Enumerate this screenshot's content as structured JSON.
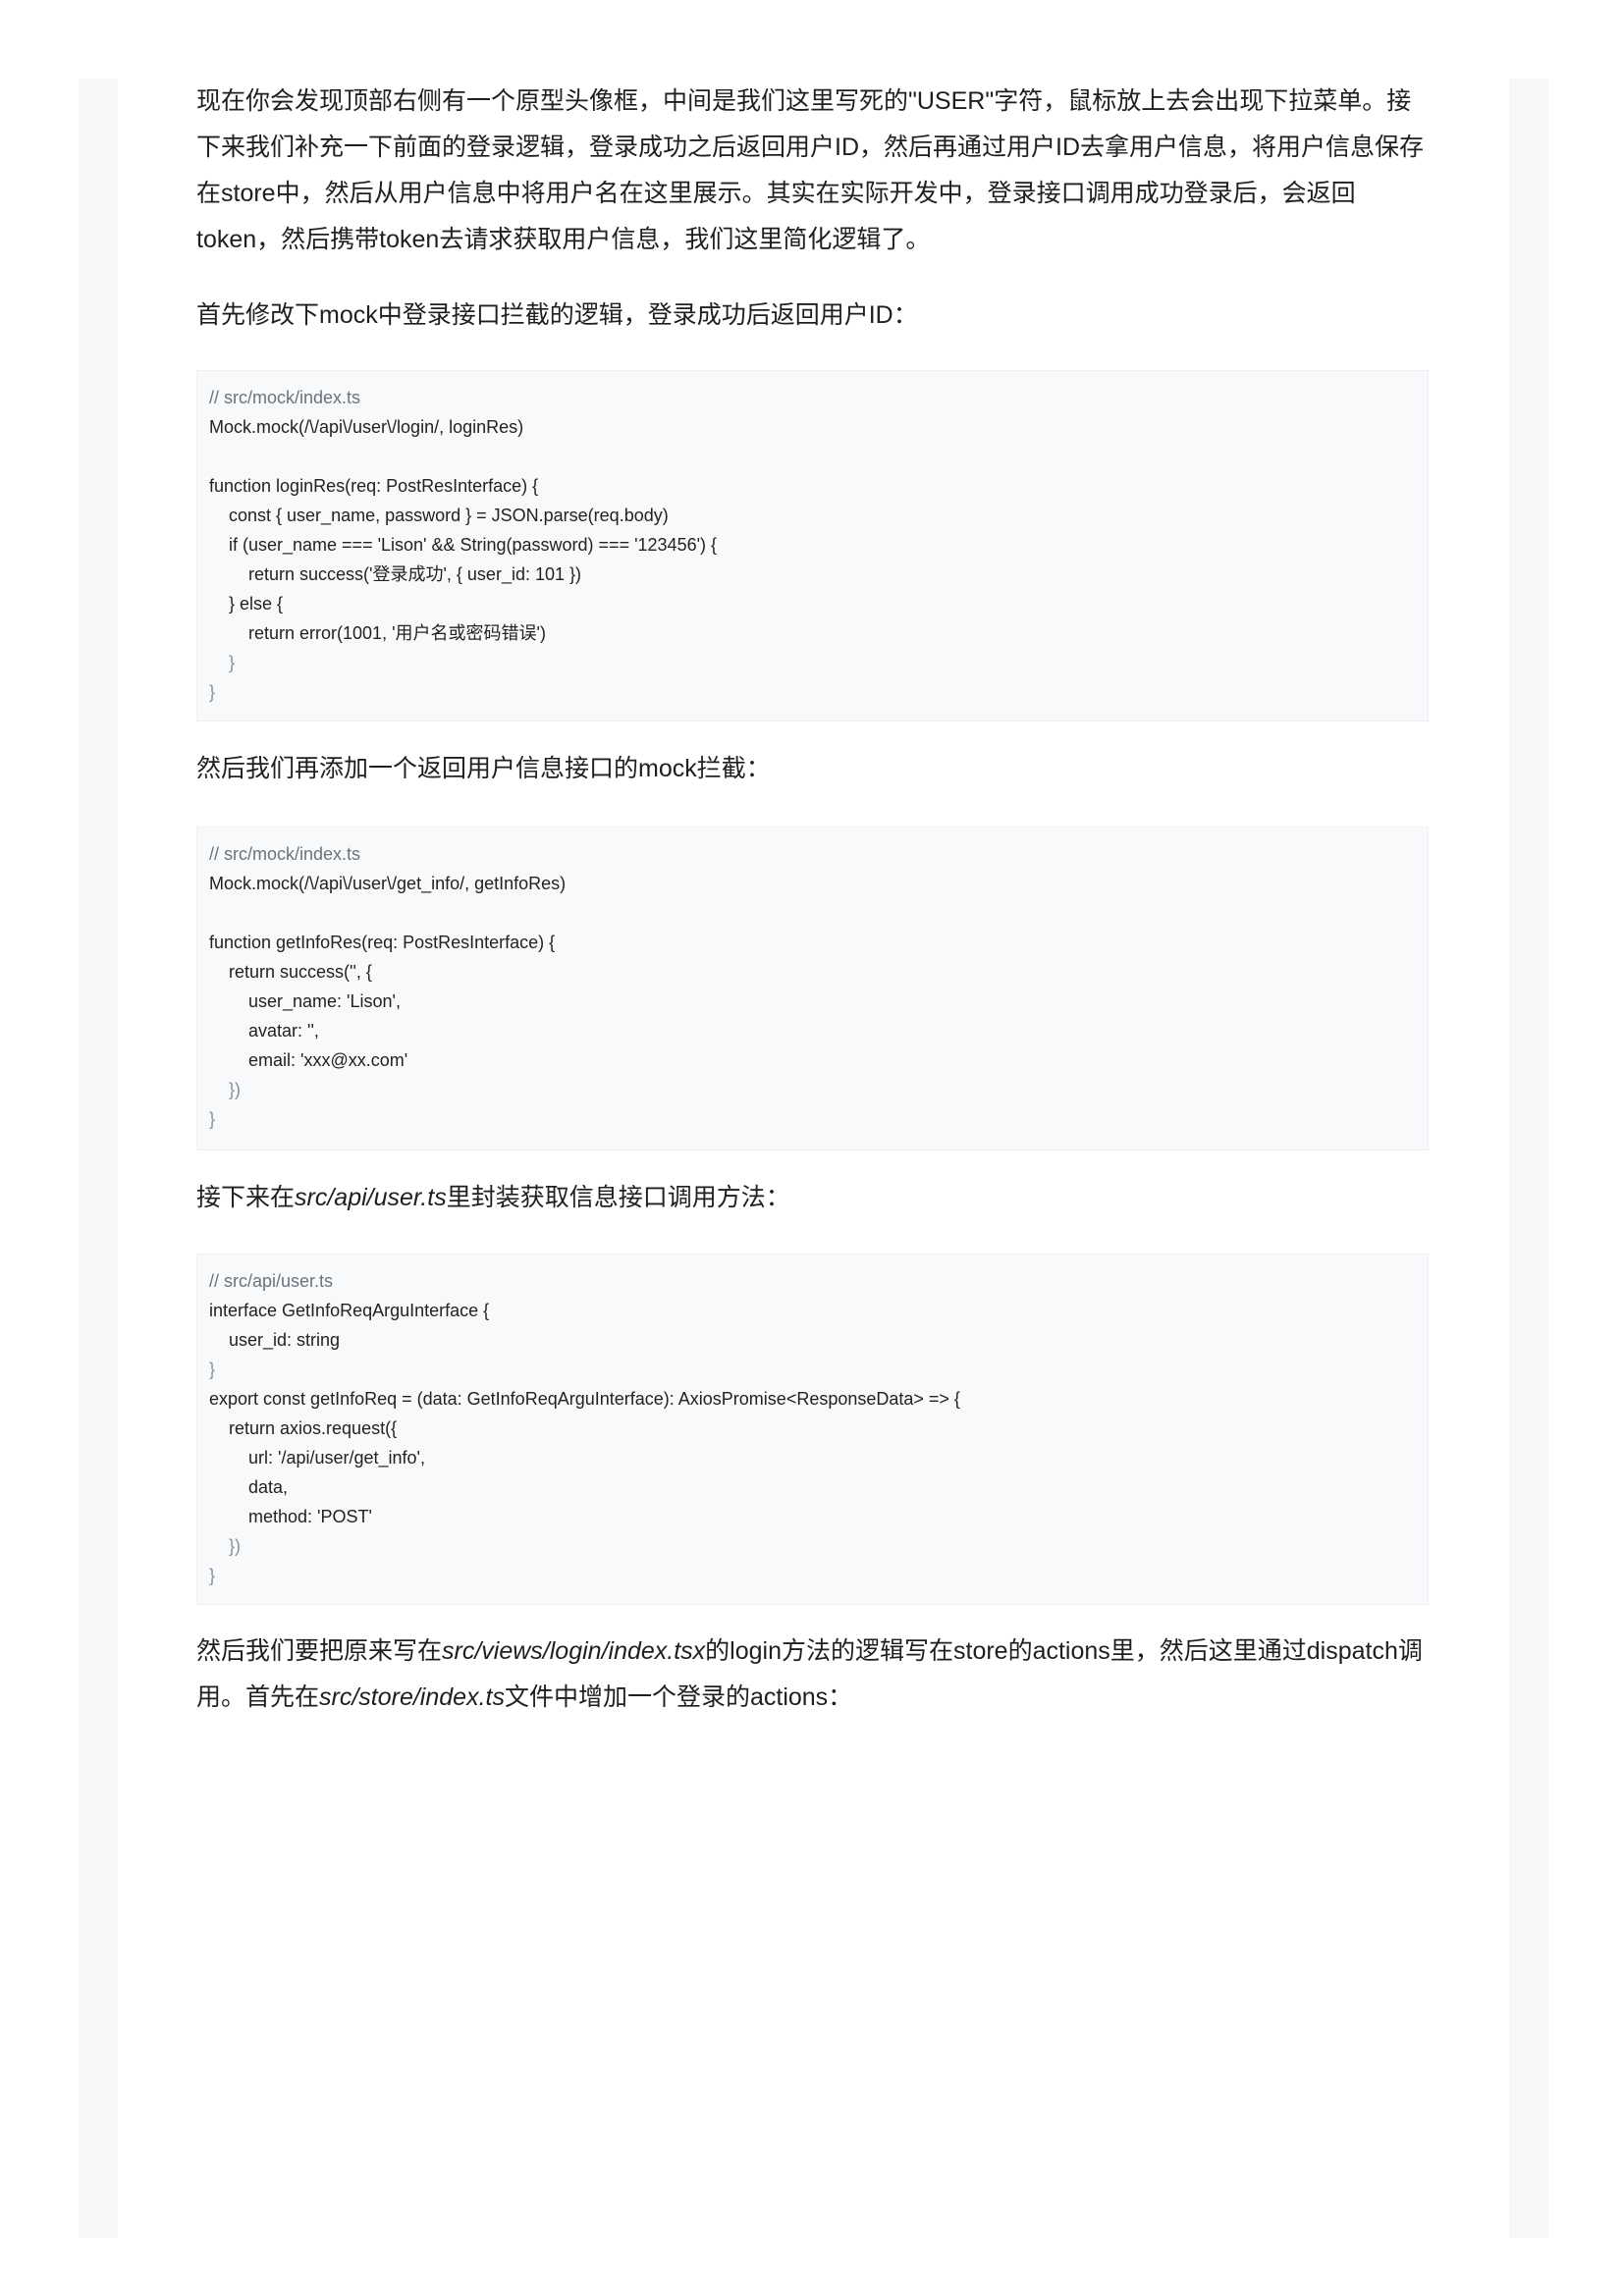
{
  "paragraphs": {
    "p1": "现在你会发现顶部右侧有一个原型头像框，中间是我们这里写死的\"USER\"字符，鼠标放上去会出现下拉菜单。接下来我们补充一下前面的登录逻辑，登录成功之后返回用户ID，然后再通过用户ID去拿用户信息，将用户信息保存在store中，然后从用户信息中将用户名在这里展示。其实在实际开发中，登录接口调用成功登录后，会返回token，然后携带token去请求获取用户信息，我们这里简化逻辑了。",
    "p2": "首先修改下mock中登录接口拦截的逻辑，登录成功后返回用户ID：",
    "p3": "然后我们再添加一个返回用户信息接口的mock拦截：",
    "p4_pre": "接下来在",
    "p4_path": "src/api/user.ts",
    "p4_post": "里封装获取信息接口调用方法：",
    "p5_a": "然后我们要把原来写在",
    "p5_path1": "src/views/login/index.tsx",
    "p5_b": "的login方法的逻辑写在store的actions里，然后这里通过dispatch调用。首先在",
    "p5_path2": "src/store/index.ts",
    "p5_c": "文件中增加一个登录的actions："
  },
  "code_blocks": [
    {
      "lines": [
        "// src/mock/index.ts",
        "Mock.mock(/\\/api\\/user\\/login/, loginRes)",
        "",
        "function loginRes(req: PostResInterface) {",
        "const { user_name, password } = JSON.parse(req.body)",
        "if (user_name === 'Lison' && String(password) === '123456') {",
        "return success('登录成功', { user_id: 101 })",
        "} else {",
        "return error(1001, '用户名或密码错误')",
        "}",
        "}"
      ]
    },
    {
      "lines": [
        "// src/mock/index.ts",
        "Mock.mock(/\\/api\\/user\\/get_info/, getInfoRes)",
        "",
        "function getInfoRes(req: PostResInterface) {",
        "return success('', {",
        "user_name: 'Lison',",
        "avatar: '',",
        "email: 'xxx@xx.com'",
        "})",
        "}"
      ]
    },
    {
      "lines": [
        "// src/api/user.ts",
        "interface GetInfoReqArguInterface {",
        "user_id: string",
        "}",
        "export const getInfoReq = (data: GetInfoReqArguInterface): AxiosPromise<ResponseData> => {",
        "return axios.request({",
        "url: '/api/user/get_info',",
        "data,",
        "method: 'POST'",
        "})",
        "}"
      ]
    }
  ],
  "colors": {
    "keyword": "#1ea3c6",
    "function": "#d6286f",
    "string": "#6aa11a",
    "regex": "#e0a010",
    "number": "#9b6ad6",
    "comment": "#6a737d"
  }
}
